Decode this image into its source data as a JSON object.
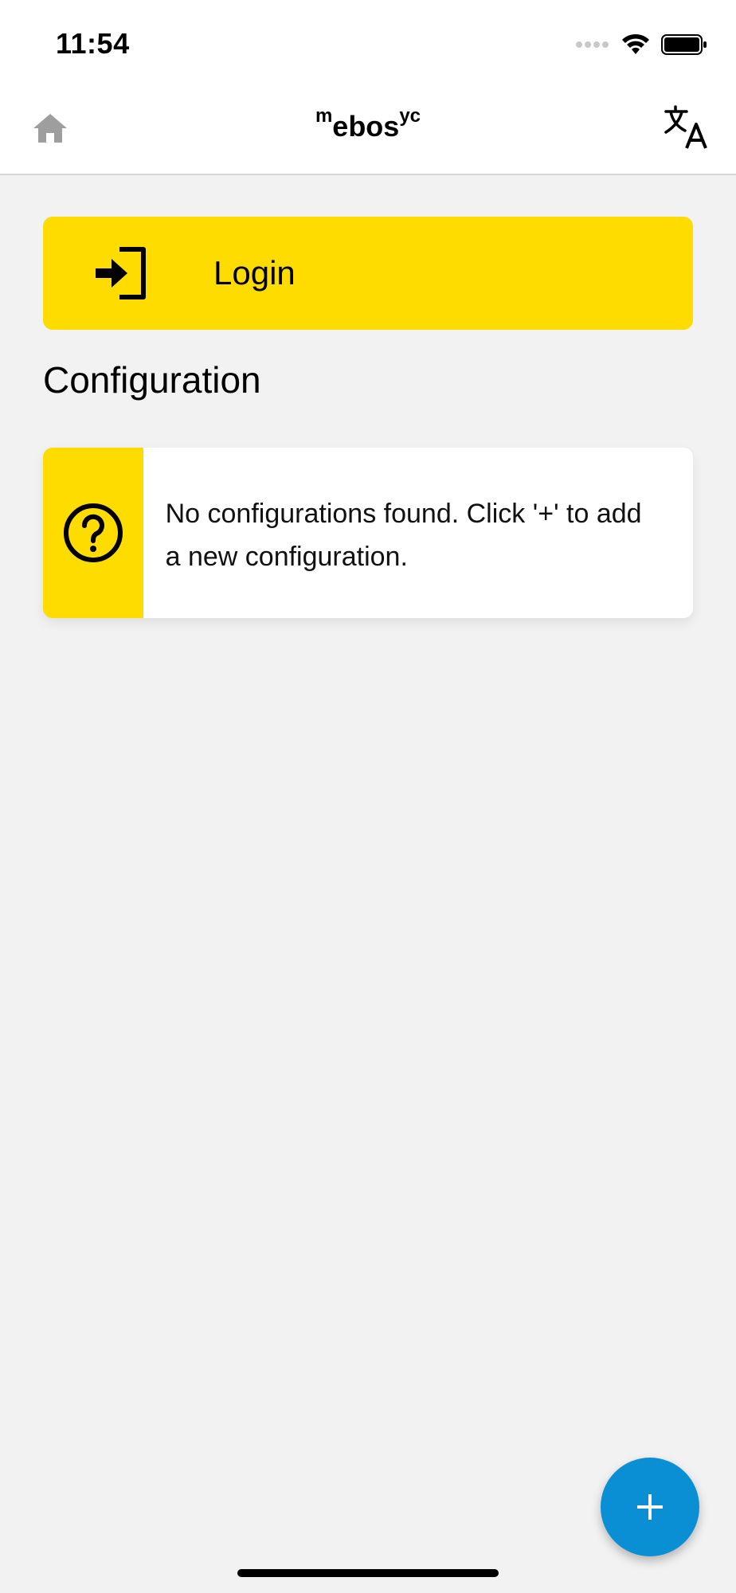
{
  "status_bar": {
    "time": "11:54",
    "icons": [
      "signal-dots-icon",
      "wifi-icon",
      "battery-icon"
    ]
  },
  "navbar": {
    "brand": {
      "sup_left": "m",
      "main": "ebos",
      "sup_right": "yc"
    },
    "icons": {
      "home": "home-icon",
      "translate": "translate-icon"
    }
  },
  "login": {
    "label": "Login",
    "icon": "login-enter-icon"
  },
  "configuration": {
    "title": "Configuration",
    "empty_message": "No configurations found. Click '+' to add a new configuration.",
    "icon": "help-circle-icon"
  },
  "fab": {
    "icon": "plus-icon"
  },
  "colors": {
    "accent_yellow": "#ffdc00",
    "fab_blue": "#0a8fd4",
    "background": "#f2f2f2"
  }
}
